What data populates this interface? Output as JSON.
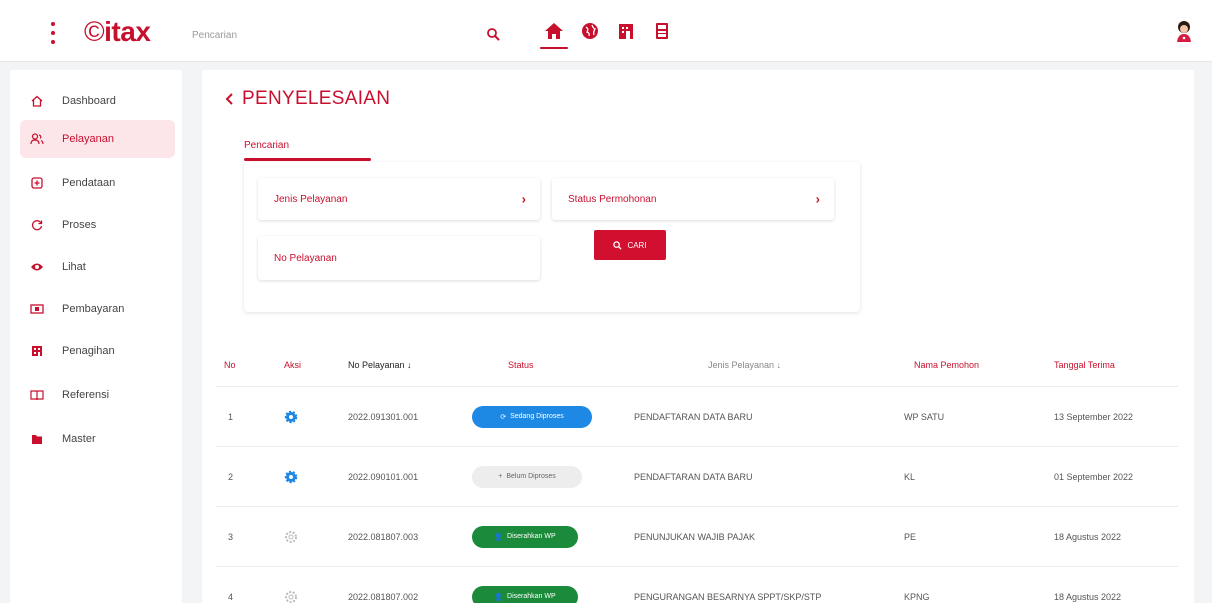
{
  "header": {
    "logo_text": "itax",
    "search_placeholder": "Pencarian",
    "nav_icons": [
      "home-icon",
      "globe-icon",
      "building-icon",
      "calculator-icon"
    ]
  },
  "sidebar": {
    "items": [
      {
        "label": "Dashboard",
        "icon": "home-outline-icon",
        "active": false
      },
      {
        "label": "Pelayanan",
        "icon": "users-icon",
        "active": true
      },
      {
        "label": "Pendataan",
        "icon": "plus-square-icon",
        "active": false
      },
      {
        "label": "Proses",
        "icon": "refresh-icon",
        "active": false
      },
      {
        "label": "Lihat",
        "icon": "eye-icon",
        "active": false
      },
      {
        "label": "Pembayaran",
        "icon": "cash-icon",
        "active": false
      },
      {
        "label": "Penagihan",
        "icon": "building-icon",
        "active": false
      },
      {
        "label": "Referensi",
        "icon": "book-icon",
        "active": false
      },
      {
        "label": "Master",
        "icon": "folder-icon",
        "active": false
      }
    ]
  },
  "main": {
    "title": "PENYELESAIAN",
    "tab_label": "Pencarian",
    "fields": {
      "jenis_pelayanan": "Jenis Pelayanan",
      "status_permohonan": "Status Permohonan",
      "no_pelayanan": "No Pelayanan"
    },
    "cari_label": "CARI"
  },
  "table": {
    "headers": {
      "no": "No",
      "aksi": "Aksi",
      "no_pelayanan": "No Pelayanan",
      "status": "Status",
      "jenis_pelayanan": "Jenis Pelayanan",
      "nama_pemohon": "Nama Pemohon",
      "tanggal_terima": "Tanggal Terima"
    },
    "rows": [
      {
        "no": "1",
        "no_pelayanan": "2022.091301.001",
        "status": "Sedang Diproses",
        "status_color": "#1e88e5",
        "jenis": "PENDAFTARAN DATA BARU",
        "nama": "WP SATU",
        "tanggal": "13 September 2022",
        "aksi_active": true
      },
      {
        "no": "2",
        "no_pelayanan": "2022.090101.001",
        "status": "Belum Diproses",
        "status_color": "#ededed",
        "jenis": "PENDAFTARAN DATA BARU",
        "nama": "KL",
        "tanggal": "01 September 2022",
        "aksi_active": true
      },
      {
        "no": "3",
        "no_pelayanan": "2022.081807.003",
        "status": "Diserahkan WP",
        "status_color": "#1b8a3a",
        "jenis": "PENUNJUKAN WAJIB PAJAK",
        "nama": "PE",
        "tanggal": "18 Agustus 2022",
        "aksi_active": false
      },
      {
        "no": "4",
        "no_pelayanan": "2022.081807.002",
        "status": "Diserahkan WP",
        "status_color": "#1b8a3a",
        "jenis": "PENGURANGAN BESARNYA SPPT/SKP/STP",
        "nama": "KPNG",
        "tanggal": "18 Agustus 2022",
        "aksi_active": false
      }
    ]
  },
  "colors": {
    "accent": "#c8102e",
    "blue": "#1e88e5",
    "green": "#1b8a3a"
  }
}
